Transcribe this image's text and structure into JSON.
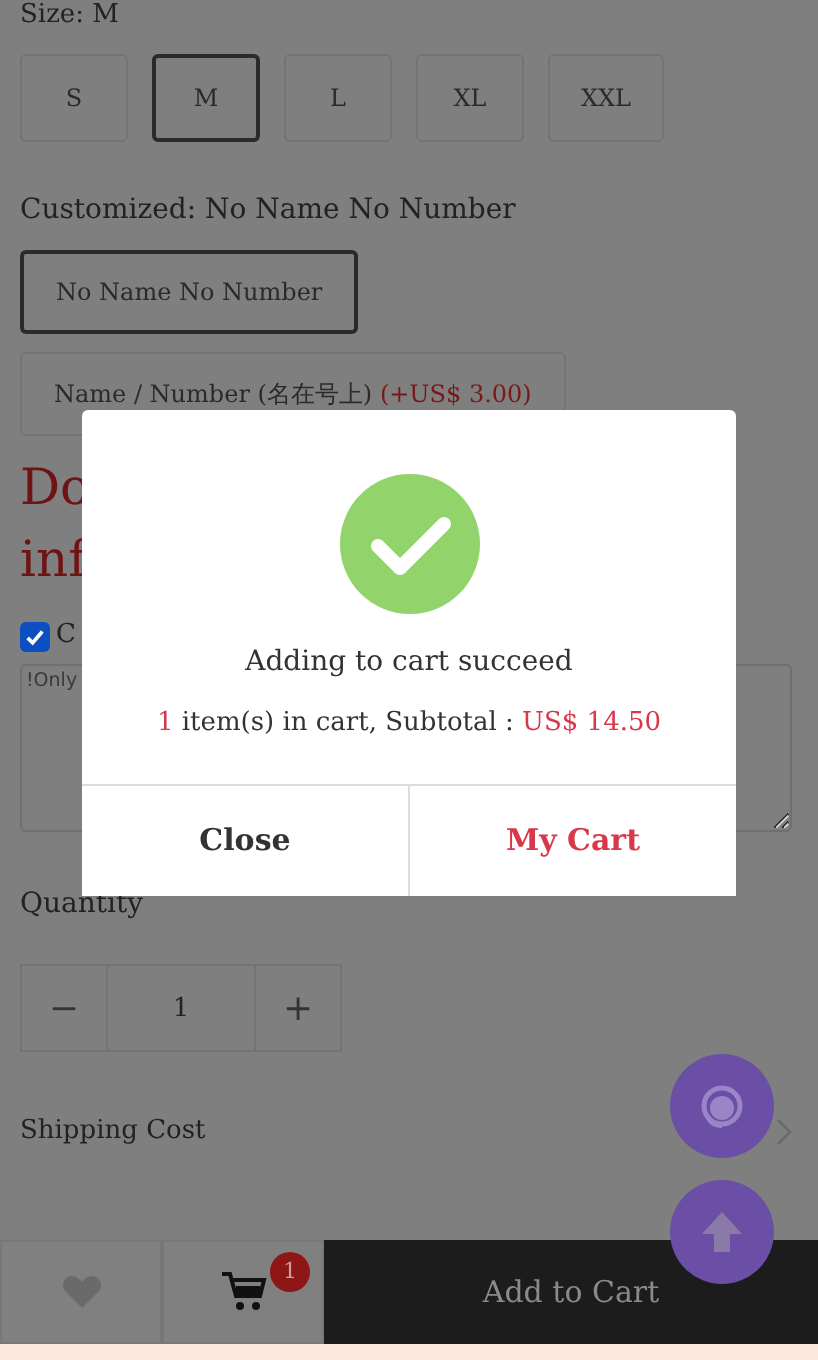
{
  "size": {
    "label": "Size: M",
    "options": [
      {
        "label": "S",
        "selected": false
      },
      {
        "label": "M",
        "selected": true
      },
      {
        "label": "L",
        "selected": false
      },
      {
        "label": "XL",
        "selected": false
      },
      {
        "label": "XXL",
        "selected": false
      }
    ]
  },
  "customized": {
    "label": "Customized: No Name No Number",
    "options": [
      {
        "label": "No Name No Number",
        "selected": true
      },
      {
        "label": "Name / Number (名在号上)",
        "price": "(+US$ 3.00)",
        "selected": false
      }
    ]
  },
  "notice": {
    "lines": [
      "Do",
      "inf"
    ]
  },
  "custom_checkbox": {
    "label": "C",
    "checked": true
  },
  "note_field": {
    "placeholder": "!Only"
  },
  "quantity": {
    "label": "Quantity",
    "minus": "−",
    "value": "1",
    "plus": "+"
  },
  "shipping": {
    "label": "Shipping Cost"
  },
  "bottom_bar": {
    "cart_count": "1",
    "add_button": "Add to Cart"
  },
  "dialog": {
    "message": "Adding to cart succeed",
    "count": "1",
    "summary": " item(s) in cart, Subtotal : ",
    "subtotal": "US$ 14.50",
    "buttons": [
      {
        "label": "Close",
        "kind": "plain"
      },
      {
        "label": "My Cart",
        "kind": "primary"
      }
    ]
  }
}
